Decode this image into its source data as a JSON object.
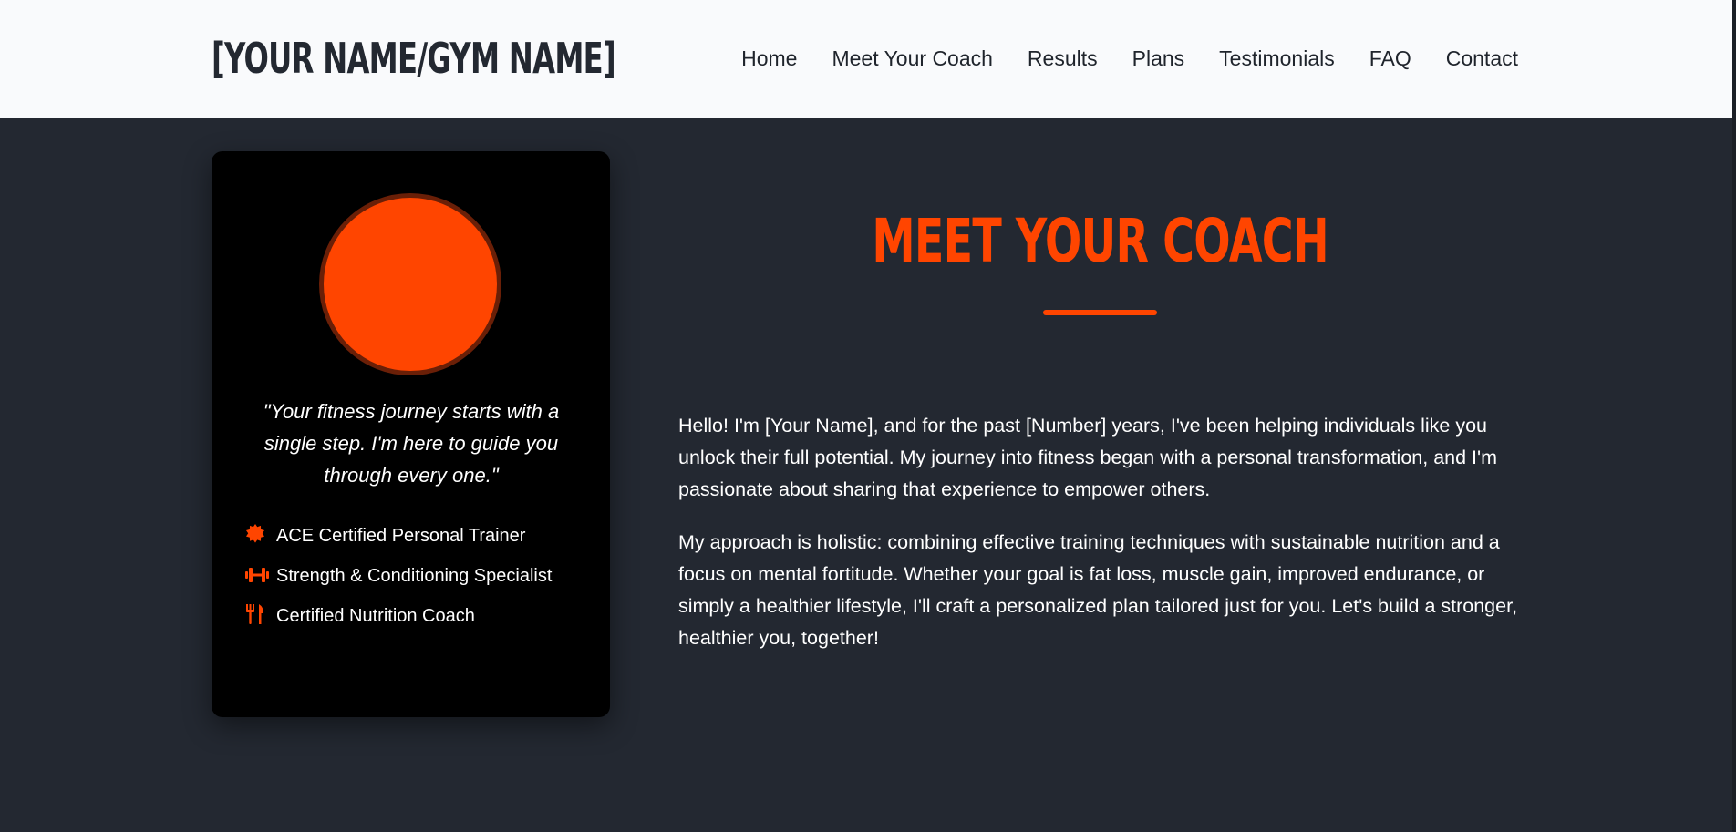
{
  "header": {
    "logo": "[YOUR NAME/GYM NAME]",
    "nav": [
      "Home",
      "Meet Your Coach",
      "Results",
      "Plans",
      "Testimonials",
      "FAQ",
      "Contact"
    ]
  },
  "card": {
    "quote": "\"Your fitness journey starts with a single step. I'm here to guide you through every one.\"",
    "certifications": [
      {
        "icon": "certificate-icon",
        "label": "ACE Certified Personal Trainer"
      },
      {
        "icon": "dumbbell-icon",
        "label": "Strength & Conditioning Specialist"
      },
      {
        "icon": "utensils-icon",
        "label": "Certified Nutrition Coach"
      }
    ]
  },
  "section": {
    "title": "MEET YOUR COACH",
    "paragraphs": [
      "Hello! I'm [Your Name], and for the past [Number] years, I've been helping individuals like you unlock their full potential. My journey into fitness began with a personal transformation, and I'm passionate about sharing that experience to empower others.",
      "My approach is holistic: combining effective training techniques with sustainable nutrition and a focus on mental fortitude. Whether your goal is fat loss, muscle gain, improved endurance, or simply a healthier lifestyle, I'll craft a personalized plan tailored just for you. Let's build a stronger, healthier you, together!"
    ]
  },
  "colors": {
    "accent": "#ff4500",
    "background": "#232831",
    "header": "#f9fafc",
    "card": "#000000"
  }
}
